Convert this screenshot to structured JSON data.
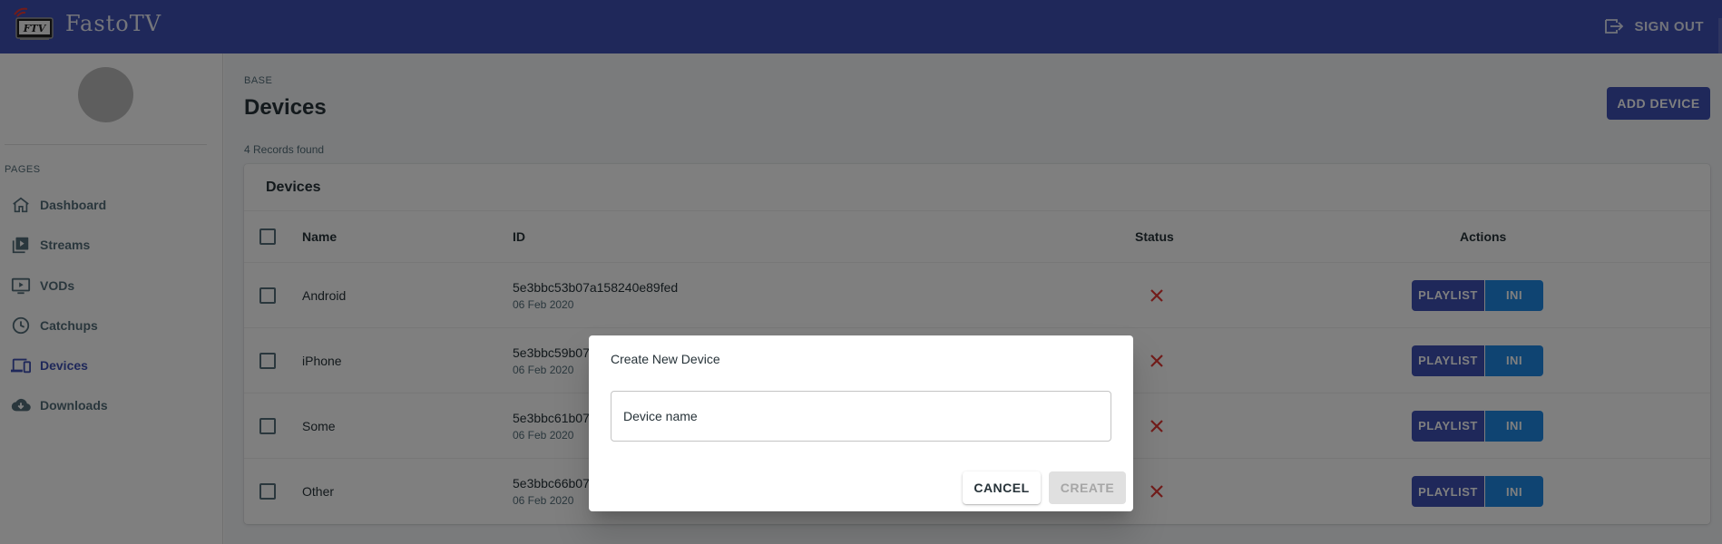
{
  "app": {
    "brand": "FastoTV",
    "logo_text": "FTV"
  },
  "header": {
    "sign_out_label": "SIGN OUT"
  },
  "sidebar": {
    "section_title": "PAGES",
    "items": [
      {
        "label": "Dashboard",
        "icon": "home-icon",
        "active": false
      },
      {
        "label": "Streams",
        "icon": "streams-icon",
        "active": false
      },
      {
        "label": "VODs",
        "icon": "tv-icon",
        "active": false
      },
      {
        "label": "Catchups",
        "icon": "clock-icon",
        "active": false
      },
      {
        "label": "Devices",
        "icon": "devices-icon",
        "active": true
      },
      {
        "label": "Downloads",
        "icon": "cloud-download-icon",
        "active": false
      }
    ]
  },
  "main": {
    "overline": "BASE",
    "title": "Devices",
    "add_button_label": "ADD DEVICE",
    "records_found": "4 Records found",
    "card_title": "Devices",
    "table": {
      "columns": [
        "Name",
        "ID",
        "Status",
        "Actions"
      ],
      "rows": [
        {
          "name": "Android",
          "id": "5e3bbc53b07a158240e89fed",
          "date": "06 Feb 2020",
          "status": "inactive"
        },
        {
          "name": "iPhone",
          "id": "5e3bbc59b07",
          "date": "06 Feb 2020",
          "status": "inactive"
        },
        {
          "name": "Some",
          "id": "5e3bbc61b07",
          "date": "06 Feb 2020",
          "status": "inactive"
        },
        {
          "name": "Other",
          "id": "5e3bbc66b07",
          "date": "06 Feb 2020",
          "status": "inactive"
        }
      ],
      "action_labels": {
        "playlist": "PLAYLIST",
        "ini": "INI"
      }
    }
  },
  "dialog": {
    "title": "Create New Device",
    "input_placeholder": "Device name",
    "input_value": "",
    "cancel_label": "CANCEL",
    "create_label": "CREATE"
  },
  "colors": {
    "primary": "#3f51b5",
    "secondary": "#1e88e5",
    "error": "#e53935",
    "backdrop": "rgba(0,0,0,0.5)"
  }
}
